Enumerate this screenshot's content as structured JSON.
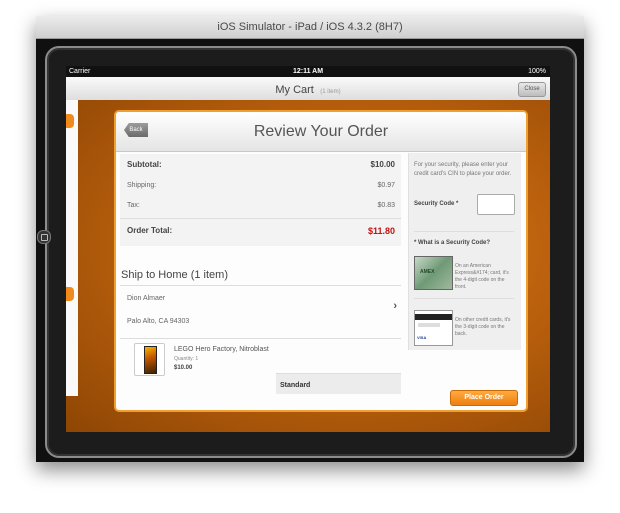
{
  "window": {
    "title": "iOS Simulator - iPad / iOS 4.3.2 (8H7)"
  },
  "statusbar": {
    "carrier": "Carrier",
    "wifi_icon": "wifi-icon",
    "time": "12:11 AM",
    "battery": "100%"
  },
  "navbar": {
    "title": "My Cart",
    "subtitle": "(1 item)",
    "close_label": "Close"
  },
  "review": {
    "title": "Review Your Order",
    "back_label": "Back",
    "subtotal_label": "Subtotal:",
    "subtotal_value": "$10.00",
    "shipping_label": "Shipping:",
    "shipping_value": "$0.97",
    "tax_label": "Tax:",
    "tax_value": "$0.83",
    "total_label": "Order Total:",
    "total_value": "$11.80"
  },
  "shipping": {
    "title": "Ship to Home (1 item)",
    "name": "Dion Almaer",
    "city": "Palo Alto, CA 94303",
    "method": "Standard"
  },
  "product": {
    "name": "LEGO Hero Factory, Nitroblast",
    "quantity": "Quantity: 1",
    "price": "$10.00"
  },
  "security": {
    "note": "For your security, please enter your credit card's CIN to place your order.",
    "code_label": "Security Code *",
    "what_label": "* What is a Security Code?",
    "amex_text": "On an American Express&#174; card, it's the 4-digit code on the front.",
    "other_text": "On other credit cards, it's the 3-digit code on the back.",
    "card_logos": "VISA"
  },
  "actions": {
    "place_order": "Place Order"
  },
  "colors": {
    "accent": "#f08a1c",
    "total": "#c41010"
  }
}
